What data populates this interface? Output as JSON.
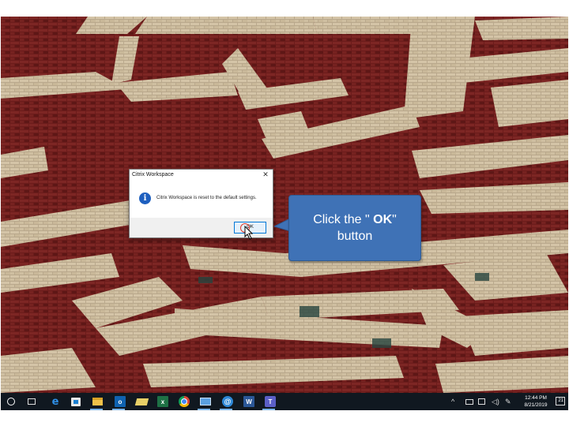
{
  "dialog": {
    "title": "Citrix Workspace",
    "close_glyph": "✕",
    "message": "Citrix Workspace is reset to the default settings.",
    "icon": "info-icon",
    "ok_label": "OK"
  },
  "callout": {
    "prefix": "Click the \"",
    "emphasis": " OK",
    "suffix": "\"",
    "line2": "button",
    "color": "#3f72b6"
  },
  "taskbar": {
    "apps": [
      "start-icon",
      "task-view-icon",
      "edge-icon",
      "store-icon",
      "file-explorer-icon",
      "outlook-icon",
      "notes-icon",
      "excel-icon",
      "chrome-icon",
      "remote-desktop-icon",
      "citrix-workspace-icon",
      "word-icon",
      "teams-icon"
    ],
    "outlook_letter": "o",
    "excel_letter": "x",
    "word_letter": "W",
    "teams_letter": "T",
    "edge_glyph": "e",
    "citrix_glyph": "@",
    "tray": {
      "chevron": "^",
      "volume_glyph": "◁)",
      "pen_glyph": "✎",
      "time": "12:44 PM",
      "date": "8/21/2019",
      "notifications": "21"
    }
  },
  "colors": {
    "brick_red": "#6e1d1c",
    "stone": "#cdbda0",
    "taskbar": "#101820",
    "accent": "#0078d7"
  }
}
